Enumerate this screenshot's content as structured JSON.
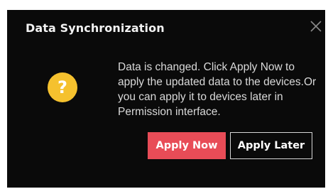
{
  "dialog": {
    "title": "Data Synchronization",
    "icon": "question-icon",
    "icon_glyph": "?",
    "icon_color": "#f5c12e",
    "message": "Data is changed. Click Apply Now to apply the updated data to the devices.Or you can apply it to devices later in Permission interface.",
    "close_icon": "close-icon",
    "buttons": {
      "apply_now": "Apply Now",
      "apply_later": "Apply Later"
    }
  },
  "colors": {
    "background": "#0a0a0a",
    "primary": "#e84c57"
  }
}
